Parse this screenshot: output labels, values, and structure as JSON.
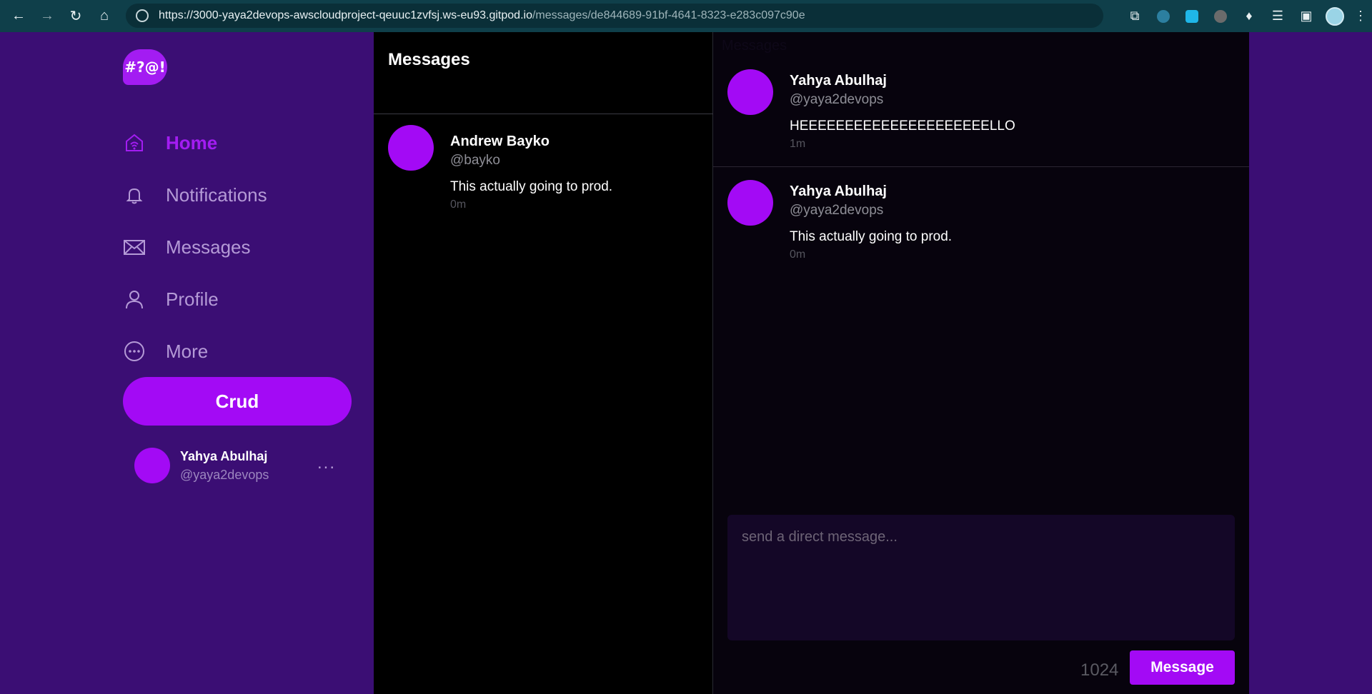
{
  "browser": {
    "url_host": "https://3000-yaya2devops-awscloudproject-qeuuc1zvfsj.ws-eu93.gitpod.io",
    "url_path": "/messages/de844689-91bf-4641-8323-e283c097c90e",
    "icons": [
      "back-icon",
      "forward-icon",
      "reload-icon",
      "home-icon",
      "site-info-icon"
    ],
    "extension_icons": [
      "screenshot-icon",
      "extension-icon-1",
      "extension-icon-2",
      "extension-icon-3",
      "puzzle-icon",
      "playlist-icon",
      "sidepanel-icon",
      "profile-icon",
      "menu-icon"
    ]
  },
  "brand": {
    "logo_text": "#?@!",
    "accent": "#a30af5",
    "sidebar_bg": "#3b0e74"
  },
  "sidebar": {
    "items": [
      {
        "label": "Home",
        "icon": "home-icon",
        "active": true
      },
      {
        "label": "Notifications",
        "icon": "bell-icon",
        "active": false
      },
      {
        "label": "Messages",
        "icon": "envelope-icon",
        "active": false
      },
      {
        "label": "Profile",
        "icon": "person-icon",
        "active": false
      },
      {
        "label": "More",
        "icon": "more-circle-icon",
        "active": false
      }
    ],
    "crud_label": "Crud",
    "user": {
      "name": "Yahya Abulhaj",
      "handle": "@yaya2devops",
      "more": "..."
    }
  },
  "message_groups": {
    "title": "Messages",
    "items": [
      {
        "name": "Andrew Bayko",
        "handle": "@bayko",
        "message": "This actually going to prod.",
        "time": "0m"
      }
    ]
  },
  "conversation": {
    "ghost_heading": "Messages",
    "messages": [
      {
        "name": "Yahya Abulhaj",
        "handle": "@yaya2devops",
        "message": "HEEEEEEEEEEEEEEEEEEEEELLO",
        "time": "1m"
      },
      {
        "name": "Yahya Abulhaj",
        "handle": "@yaya2devops",
        "message": "This actually going to prod.",
        "time": "0m"
      }
    ],
    "composer": {
      "placeholder": "send a direct message...",
      "value": "",
      "counter": "1024",
      "send_label": "Message"
    }
  }
}
